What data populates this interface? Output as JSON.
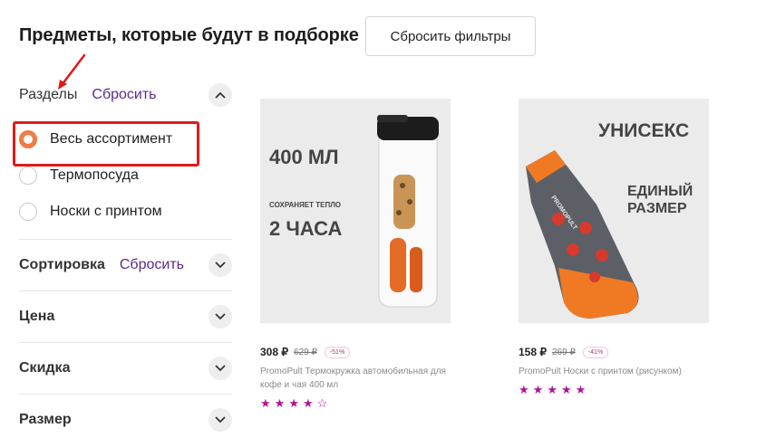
{
  "header": {
    "title": "Предметы, которые будут в подборке",
    "reset_filters": "Сбросить фильтры"
  },
  "filters": {
    "sections": {
      "title": "Разделы",
      "reset": "Сбросить",
      "options": [
        {
          "label": "Весь ассортимент",
          "checked": true
        },
        {
          "label": "Термопосуда",
          "checked": false
        },
        {
          "label": "Носки с принтом",
          "checked": false
        }
      ]
    },
    "sort": {
      "title": "Сортировка",
      "reset": "Сбросить"
    },
    "price": {
      "title": "Цена"
    },
    "discount": {
      "title": "Скидка"
    },
    "size": {
      "title": "Размер"
    }
  },
  "products": [
    {
      "image_text": {
        "volume": "400 МЛ",
        "keeps": "СОХРАНЯЕТ ТЕПЛО",
        "hours": "2 ЧАСА"
      },
      "price": "308 ₽",
      "old_price": "629 ₽",
      "discount": "-51%",
      "title": "PromoPult Термокружка автомобильная для кофе и чая 400 мл",
      "rating": 4,
      "stars": [
        "★",
        "★",
        "★",
        "★",
        "☆"
      ]
    },
    {
      "image_text": {
        "unisex": "УНИСЕКС",
        "size1": "ЕДИНЫЙ",
        "size2": "РАЗМЕР",
        "brand": "PROMOPULT"
      },
      "price": "158 ₽",
      "old_price": "269 ₽",
      "discount": "-41%",
      "title": "PromoPult Носки с принтом (рисунком)",
      "rating": 5,
      "stars": [
        "★",
        "★",
        "★",
        "★",
        "★"
      ]
    }
  ],
  "colors": {
    "accent_purple": "#5a2a8c",
    "radio_orange": "#f27a47",
    "highlight_red": "#e0191b",
    "star_magenta": "#b0139b"
  }
}
